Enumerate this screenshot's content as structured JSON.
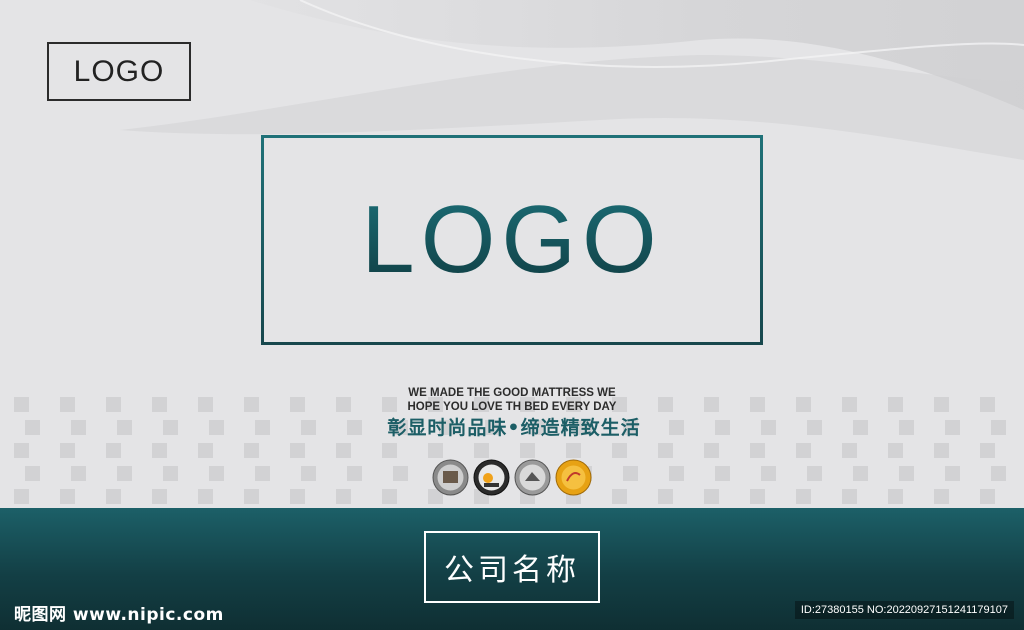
{
  "header": {
    "small_logo": "LOGO"
  },
  "center": {
    "big_logo": "LOGO",
    "slogan_en_line1": "WE MADE THE GOOD MATTRESS WE",
    "slogan_en_line2": "HOPE YOU LOVE TH BED EVERY DAY",
    "slogan_cn": "彰显时尚品味•缔造精致生活",
    "badges": [
      "badge-1",
      "badge-2",
      "badge-3",
      "badge-4"
    ]
  },
  "footer": {
    "company_name": "公司名称",
    "watermark": "昵图网 www.nipic.com",
    "id_text": "ID:27380155 NO:20220927151241179107"
  },
  "colors": {
    "accent": "#1c6068",
    "band_dark": "#0f2f33",
    "background": "#e4e4e6"
  }
}
